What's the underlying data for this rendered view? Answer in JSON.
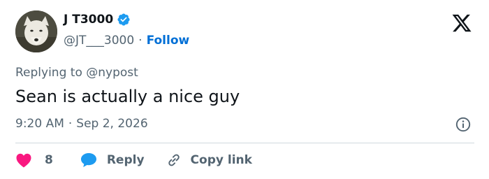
{
  "user": {
    "name": "J T3000",
    "handle": "@JT___3000",
    "separator": "·",
    "follow_label": "Follow",
    "verified": true
  },
  "reply": {
    "prefix": "Replying to",
    "mention": "@nypost"
  },
  "tweet": {
    "text": "Sean is actually a nice guy",
    "time": "9:20 AM",
    "separator": "·",
    "date": "Sep 2, 2026"
  },
  "actions": {
    "like_count": "8",
    "reply_label": "Reply",
    "copy_label": "Copy link"
  },
  "colors": {
    "accent": "#006fd6",
    "like": "#f91880",
    "reply_icon": "#1d9bf0",
    "muted": "#536471",
    "text": "#0f1419"
  },
  "icons": [
    "verified-badge-icon",
    "x-logo-icon",
    "info-icon",
    "heart-icon",
    "reply-bubble-icon",
    "link-icon"
  ]
}
